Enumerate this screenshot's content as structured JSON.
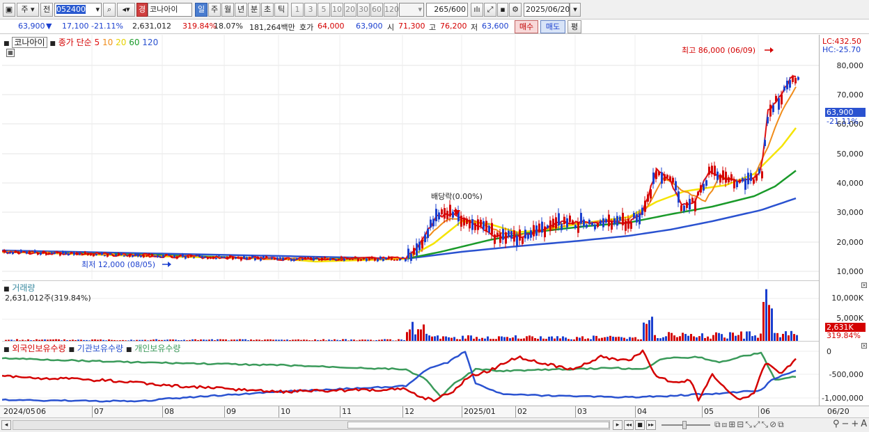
{
  "toolbar": {
    "market_type": "주",
    "period_type": "전",
    "code": "052400",
    "name_badge": "경",
    "stock_name": "코나아이",
    "periods": [
      "일",
      "주",
      "월",
      "년",
      "분",
      "초",
      "틱"
    ],
    "numbers": [
      "1",
      "3",
      "5",
      "10",
      "20",
      "30",
      "60",
      "120"
    ],
    "count": "265",
    "count_total": "/600",
    "date": "2025/06/20"
  },
  "quote": {
    "price": "63,900",
    "change": "17,100",
    "change_pct": "-21.11%",
    "volume": "2,631,012",
    "volume_ratio": "319.84%",
    "turnover": "18.07%",
    "amount": "181,264백만",
    "ask_label": "호가",
    "ask": "64,000",
    "bid": "63,900",
    "open_label": "시",
    "open": "71,300",
    "high_label": "고",
    "high": "76,200",
    "low_label": "저",
    "low": "63,600",
    "buy": "매수",
    "sell": "매도",
    "eval": "평"
  },
  "legend": {
    "stock_name": "코나아이",
    "ma_label": "종가 단순",
    "ma_periods": [
      "5",
      "10",
      "20",
      "60",
      "120"
    ],
    "volume_label": "거래량",
    "volume_value": "2,631,012주(319.84%)",
    "hold_labels": [
      "외국인보유수량",
      "기관보유수량",
      "개인보유수량"
    ]
  },
  "annotations": {
    "high": "최고 86,000 (06/09)",
    "low": "최저 12,000 (08/05)",
    "dividend": "배당락(0.00%)",
    "lc": "LC:432.50",
    "hc": "HC:-25.70"
  },
  "yaxis": {
    "price_ticks": [
      "80,000",
      "70,000",
      "60,000",
      "50,000",
      "40,000",
      "30,000",
      "20,000",
      "10,000"
    ],
    "current_price": "63,900",
    "current_pct": "-21.11%",
    "volume_ticks": [
      "10,000K",
      "5,000K"
    ],
    "current_volume": "2,631K",
    "current_volume_pct": "319.84%",
    "hold_ticks": [
      "0",
      "-500,000",
      "-1,000,000"
    ]
  },
  "xaxis": {
    "labels": [
      "2024/05",
      "06",
      "07",
      "08",
      "09",
      "10",
      "11",
      "12",
      "2025/01",
      "02",
      "03",
      "04",
      "05",
      "06",
      "06/20"
    ]
  },
  "colors": {
    "up": "#d40000",
    "down": "#1a3fcf",
    "ma5": "#e01010",
    "ma10": "#f08c1a",
    "ma20": "#f5e400",
    "ma60": "#1a9a2a",
    "ma120": "#2a52d0",
    "foreign": "#d40000",
    "institution": "#2a52d0",
    "individual": "#3a9a5a"
  }
}
